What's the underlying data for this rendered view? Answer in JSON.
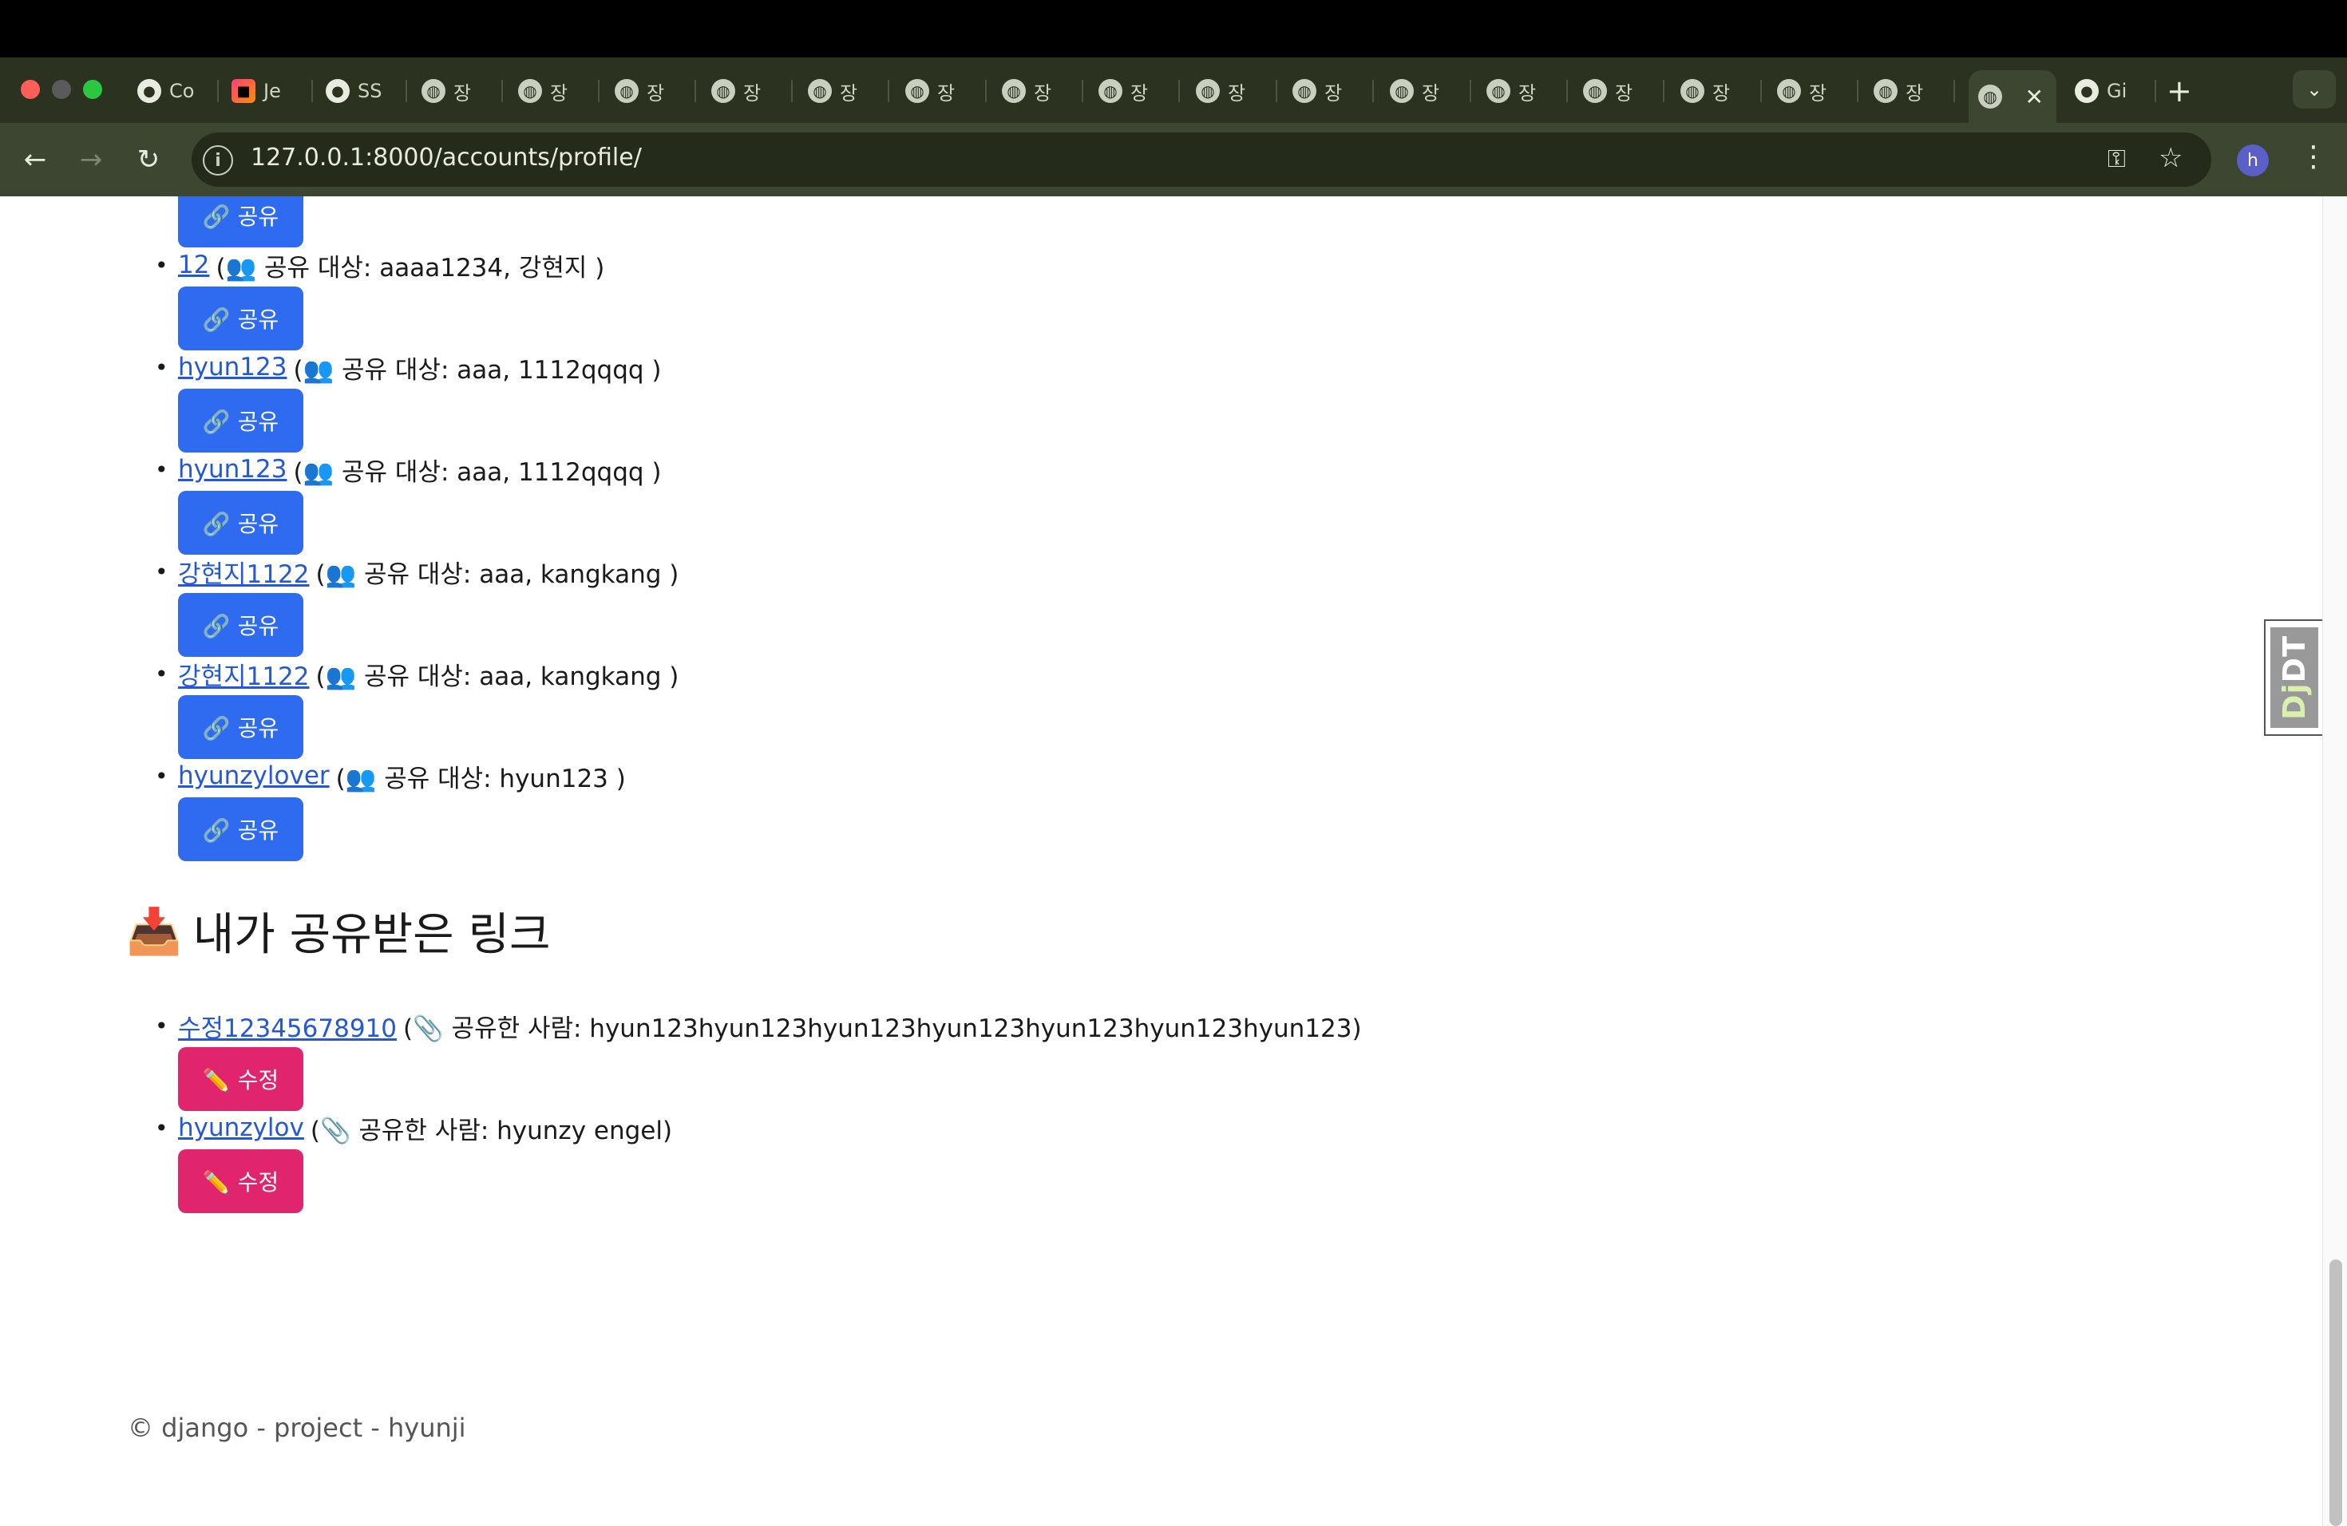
{
  "browser": {
    "tabs": [
      {
        "label": "Co",
        "icon": "github"
      },
      {
        "label": "Je",
        "icon": "jetbrains"
      },
      {
        "label": "SS",
        "icon": "github"
      },
      {
        "label": "장",
        "icon": "globe"
      },
      {
        "label": "장",
        "icon": "globe"
      },
      {
        "label": "장",
        "icon": "globe"
      },
      {
        "label": "장",
        "icon": "globe"
      },
      {
        "label": "장",
        "icon": "globe"
      },
      {
        "label": "장",
        "icon": "globe"
      },
      {
        "label": "장",
        "icon": "globe"
      },
      {
        "label": "장",
        "icon": "globe"
      },
      {
        "label": "장",
        "icon": "globe"
      },
      {
        "label": "장",
        "icon": "globe"
      },
      {
        "label": "장",
        "icon": "globe"
      },
      {
        "label": "장",
        "icon": "globe"
      },
      {
        "label": "장",
        "icon": "globe"
      },
      {
        "label": "장",
        "icon": "globe"
      },
      {
        "label": "장",
        "icon": "globe"
      },
      {
        "label": "장",
        "icon": "globe"
      },
      {
        "label": "",
        "icon": "globe",
        "active": true
      },
      {
        "label": "Gi",
        "icon": "github"
      }
    ],
    "url": "127.0.0.1:8000/accounts/profile/",
    "profile_initial": "h",
    "theme_color": "#3c4630"
  },
  "shared_links": {
    "button_label": "🔗 공유",
    "items": [
      {
        "name": "12",
        "detail": "(👥 공유 대상: aaaa1234, 강현지 )"
      },
      {
        "name": "hyun123",
        "detail": "(👥 공유 대상: aaa, 1112qqqq )"
      },
      {
        "name": "hyun123",
        "detail": "(👥 공유 대상: aaa, 1112qqqq )"
      },
      {
        "name": "강현지1122",
        "detail": "(👥 공유 대상: aaa, kangkang )"
      },
      {
        "name": "강현지1122",
        "detail": "(👥 공유 대상: aaa, kangkang )"
      },
      {
        "name": "hyunzylover",
        "detail": "(👥 공유 대상: hyun123 )"
      }
    ]
  },
  "received_links": {
    "title": "내가 공유받은 링크",
    "title_emoji": "📥",
    "button_label": "✏️ 수정",
    "items": [
      {
        "name": "수정12345678910",
        "detail": "(📎 공유한 사람: hyun123hyun123hyun123hyun123hyun123hyun123hyun123)"
      },
      {
        "name": "hyunzylov",
        "detail": "(📎 공유한 사람: hyunzy engel)"
      }
    ]
  },
  "footer": {
    "text": "© django - project - hyunji"
  },
  "debug_toolbar": {
    "label_dj": "Dj",
    "label_dt": "DT"
  },
  "colors": {
    "share_button": "#2f6bf0",
    "edit_button": "#e0246e",
    "link": "#2458d6"
  }
}
